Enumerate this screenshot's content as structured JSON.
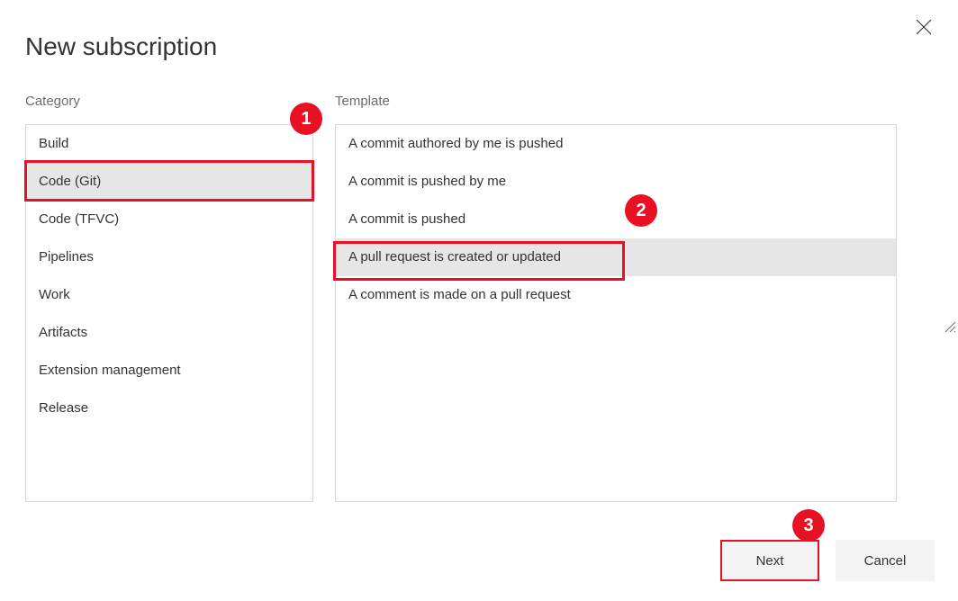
{
  "title": "New subscription",
  "labels": {
    "category": "Category",
    "template": "Template"
  },
  "categories": [
    {
      "label": "Build",
      "selected": false
    },
    {
      "label": "Code (Git)",
      "selected": true
    },
    {
      "label": "Code (TFVC)",
      "selected": false
    },
    {
      "label": "Pipelines",
      "selected": false
    },
    {
      "label": "Work",
      "selected": false
    },
    {
      "label": "Artifacts",
      "selected": false
    },
    {
      "label": "Extension management",
      "selected": false
    },
    {
      "label": "Release",
      "selected": false
    }
  ],
  "templates": [
    {
      "label": "A commit authored by me is pushed",
      "selected": false
    },
    {
      "label": "A commit is pushed by me",
      "selected": false
    },
    {
      "label": "A commit is pushed",
      "selected": false
    },
    {
      "label": "A pull request is created or updated",
      "selected": true
    },
    {
      "label": "A comment is made on a pull request",
      "selected": false
    }
  ],
  "buttons": {
    "next": "Next",
    "cancel": "Cancel"
  },
  "annotations": {
    "badge1": "1",
    "badge2": "2",
    "badge3": "3"
  }
}
